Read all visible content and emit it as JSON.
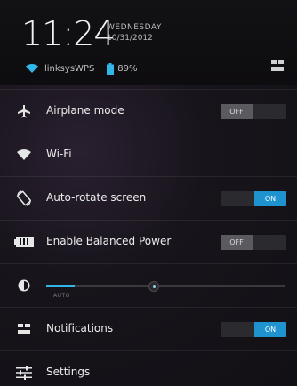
{
  "status": {
    "time": "11:24",
    "day": "WEDNESDAY",
    "date": "10/31/2012",
    "wifi_network": "linksysWPS",
    "battery_percent": "89%"
  },
  "quick_settings": [
    {
      "label": "Airplane mode",
      "icon": "airplane-icon",
      "toggle": "OFF"
    },
    {
      "label": "Wi-Fi",
      "icon": "wifi-icon"
    },
    {
      "label": "Auto-rotate screen",
      "icon": "rotate-icon",
      "toggle": "ON"
    },
    {
      "label": "Enable Balanced Power",
      "icon": "battery-icon",
      "toggle": "OFF"
    },
    {
      "label": "Notifications",
      "icon": "notifications-icon",
      "toggle": "ON"
    },
    {
      "label": "Settings",
      "icon": "settings-sliders-icon"
    }
  ],
  "brightness": {
    "label": "AUTO",
    "level": 0.12
  },
  "colors": {
    "accent": "#31b6e7",
    "toggle_on": "#1f93cf",
    "toggle_off": "#5a5a5f"
  }
}
